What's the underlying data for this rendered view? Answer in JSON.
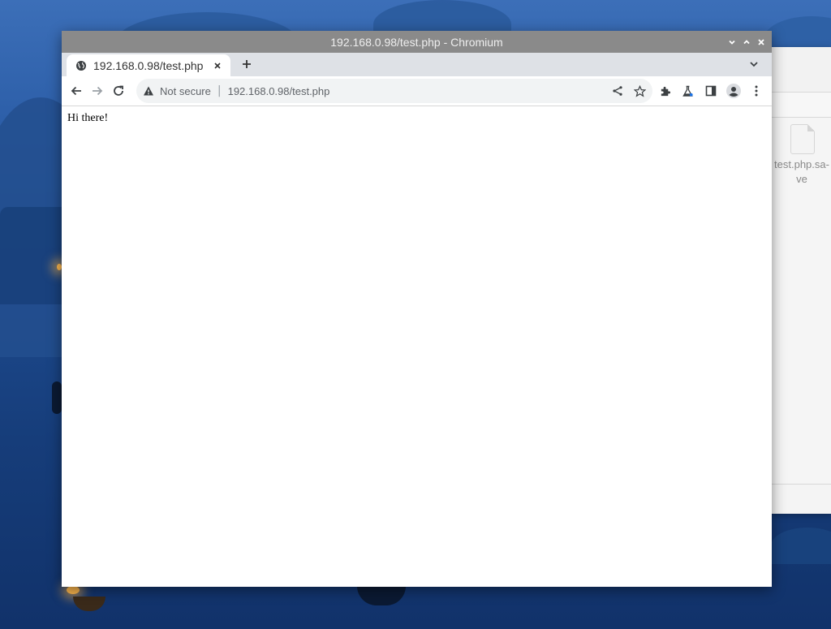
{
  "window": {
    "title": "192.168.0.98/test.php - Chromium"
  },
  "tabs": [
    {
      "title": "192.168.0.98/test.php",
      "icon": "globe-icon"
    }
  ],
  "toolbar": {
    "security_label": "Not secure",
    "separator": "|",
    "url": "192.168.0.98/test.php"
  },
  "page": {
    "text": "Hi there!"
  },
  "file_manager": {
    "file_name": "test.php.sa-ve"
  }
}
